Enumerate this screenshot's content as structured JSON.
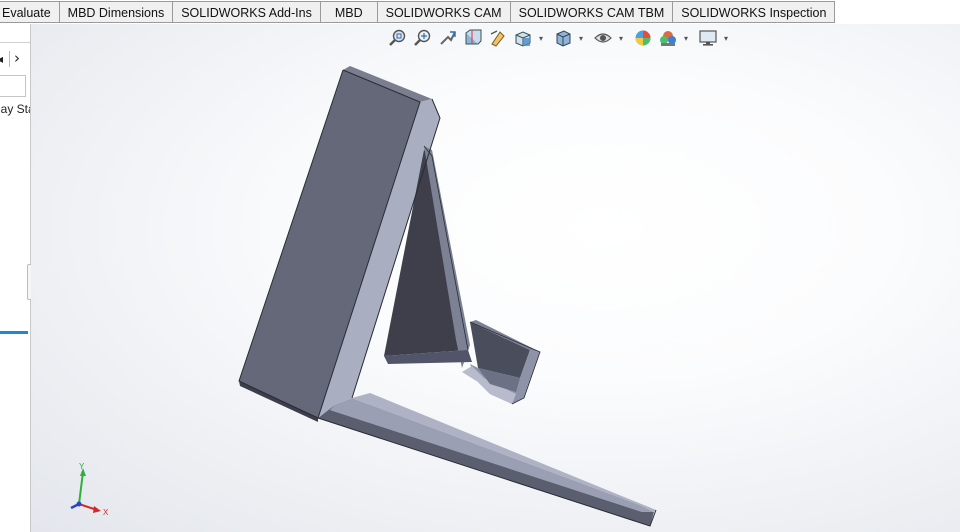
{
  "command_tabs": [
    {
      "label": "Evaluate"
    },
    {
      "label": "MBD Dimensions"
    },
    {
      "label": "SOLIDWORKS Add-Ins"
    },
    {
      "label": "MBD"
    },
    {
      "label": "SOLIDWORKS CAM"
    },
    {
      "label": "SOLIDWORKS CAM TBM"
    },
    {
      "label": "SOLIDWORKS Inspection"
    }
  ],
  "left_panel": {
    "label_fragment": "lay Sta"
  },
  "heads_up_toolbar": {
    "icons": [
      "zoom-to-fit-icon",
      "zoom-to-area-icon",
      "previous-view-icon",
      "section-view-icon",
      "dynamic-annotation-icon",
      "view-orientation-icon",
      "display-style-icon",
      "hide-show-items-icon",
      "edit-appearance-icon",
      "apply-scene-icon",
      "view-settings-icon"
    ]
  },
  "triad": {
    "y_label": "Y",
    "x_label": "X"
  },
  "colors": {
    "tab_bg": "#f0f0f0",
    "accent": "#1e88d6",
    "model_face_dark": "#3e3f4a",
    "model_face_mid": "#666a7a",
    "model_face_light": "#9a9fb4"
  }
}
